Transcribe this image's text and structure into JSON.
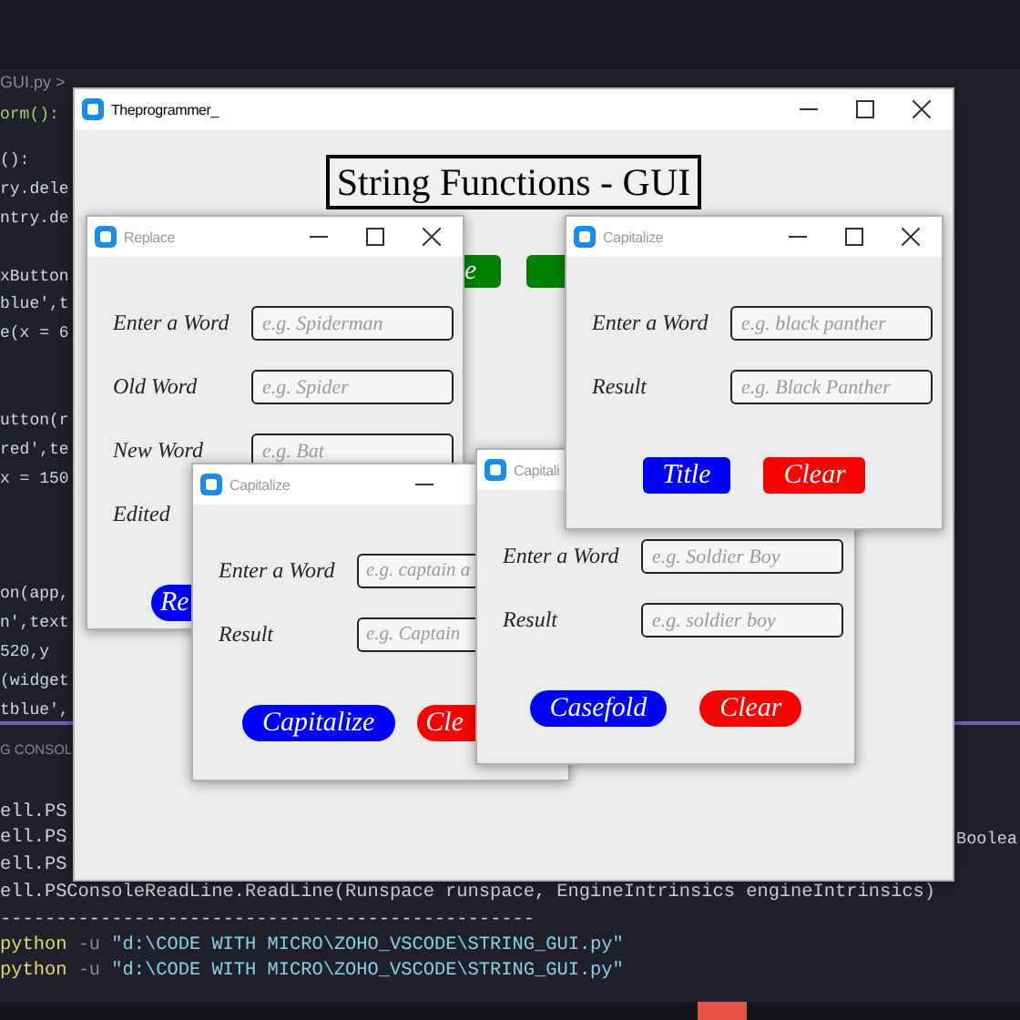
{
  "editor": {
    "breadcrumb": "GUI.py >",
    "code_lines": [
      "orm():",
      "():",
      "ry.dele",
      "ntry.de",
      "xButton",
      "blue',t",
      "e(x = 6",
      "utton(r",
      "red',te",
      "x = 150",
      "on(app,",
      "n',text",
      "520,y",
      "(widget",
      "tblue',"
    ],
    "panel_tab": "G CONSOL"
  },
  "terminal": {
    "lines": [
      {
        "kind": "text",
        "text": "ell.PS"
      },
      {
        "kind": "text",
        "text": "ell.PS"
      },
      {
        "kind": "text",
        "text": "ell.PS"
      },
      {
        "kind": "text",
        "text": "ell.PSConsoleReadLine.ReadLine(Runspace runspace, EngineIntrinsics engineIntrinsics)"
      },
      {
        "kind": "text",
        "text": "------------------------------------------------"
      },
      {
        "kind": "command",
        "command": "python",
        "flag": "-u",
        "path": "\"d:\\CODE WITH MICRO\\ZOHO_VSCODE\\STRING_GUI.py\""
      },
      {
        "kind": "command",
        "command": "python",
        "flag": "-u",
        "path": "\"d:\\CODE WITH MICRO\\ZOHO_VSCODE\\STRING_GUI.py\""
      }
    ],
    "overflow_text": "Boolea"
  },
  "windows": [
    {
      "kind": "main",
      "title": "Theprogrammer_",
      "active": true,
      "heading": "String Functions - GUI",
      "buttons": [
        {
          "label": "e",
          "color": "#008000"
        },
        {
          "color": "#008000"
        }
      ]
    },
    {
      "kind": "form",
      "title": "Replace",
      "active": false,
      "rows": [
        {
          "label": "Enter a Word",
          "placeholder": "e.g. Spiderman"
        },
        {
          "label": "Old Word",
          "placeholder": "e.g. Spider"
        },
        {
          "label": "New Word",
          "placeholder": "e.g. Bat"
        },
        {
          "label": "Edited"
        }
      ],
      "buttons": [
        {
          "label": "Re",
          "color": "#0000ff"
        }
      ]
    },
    {
      "kind": "form",
      "title": "Capitalize",
      "active": false,
      "rows": [
        {
          "label": "Enter a Word",
          "placeholder": "e.g. captain a"
        },
        {
          "label": "Result",
          "placeholder": "e.g. Captain"
        }
      ],
      "buttons": [
        {
          "label": "Capitalize",
          "color": "#0000ff"
        },
        {
          "label": "Cle",
          "color": "#ff0000"
        }
      ]
    },
    {
      "kind": "form",
      "title": "Capitali",
      "active": false,
      "rows": [
        {
          "label": "Enter a Word",
          "placeholder": "e.g. Soldier Boy"
        },
        {
          "label": "Result",
          "placeholder": "e.g. soldier boy"
        }
      ],
      "buttons": [
        {
          "label": "Casefold",
          "color": "#0000ff"
        },
        {
          "label": "Clear",
          "color": "#ff0000"
        }
      ]
    },
    {
      "kind": "form",
      "title": "Capitalize",
      "active": false,
      "rows": [
        {
          "label": "Enter a Word",
          "placeholder": "e.g. black panther"
        },
        {
          "label": "Result",
          "placeholder": "e.g. Black Panther"
        }
      ],
      "buttons": [
        {
          "label": "Title",
          "color": "#0000ff"
        },
        {
          "label": "Clear",
          "color": "#ff0000"
        }
      ]
    }
  ]
}
